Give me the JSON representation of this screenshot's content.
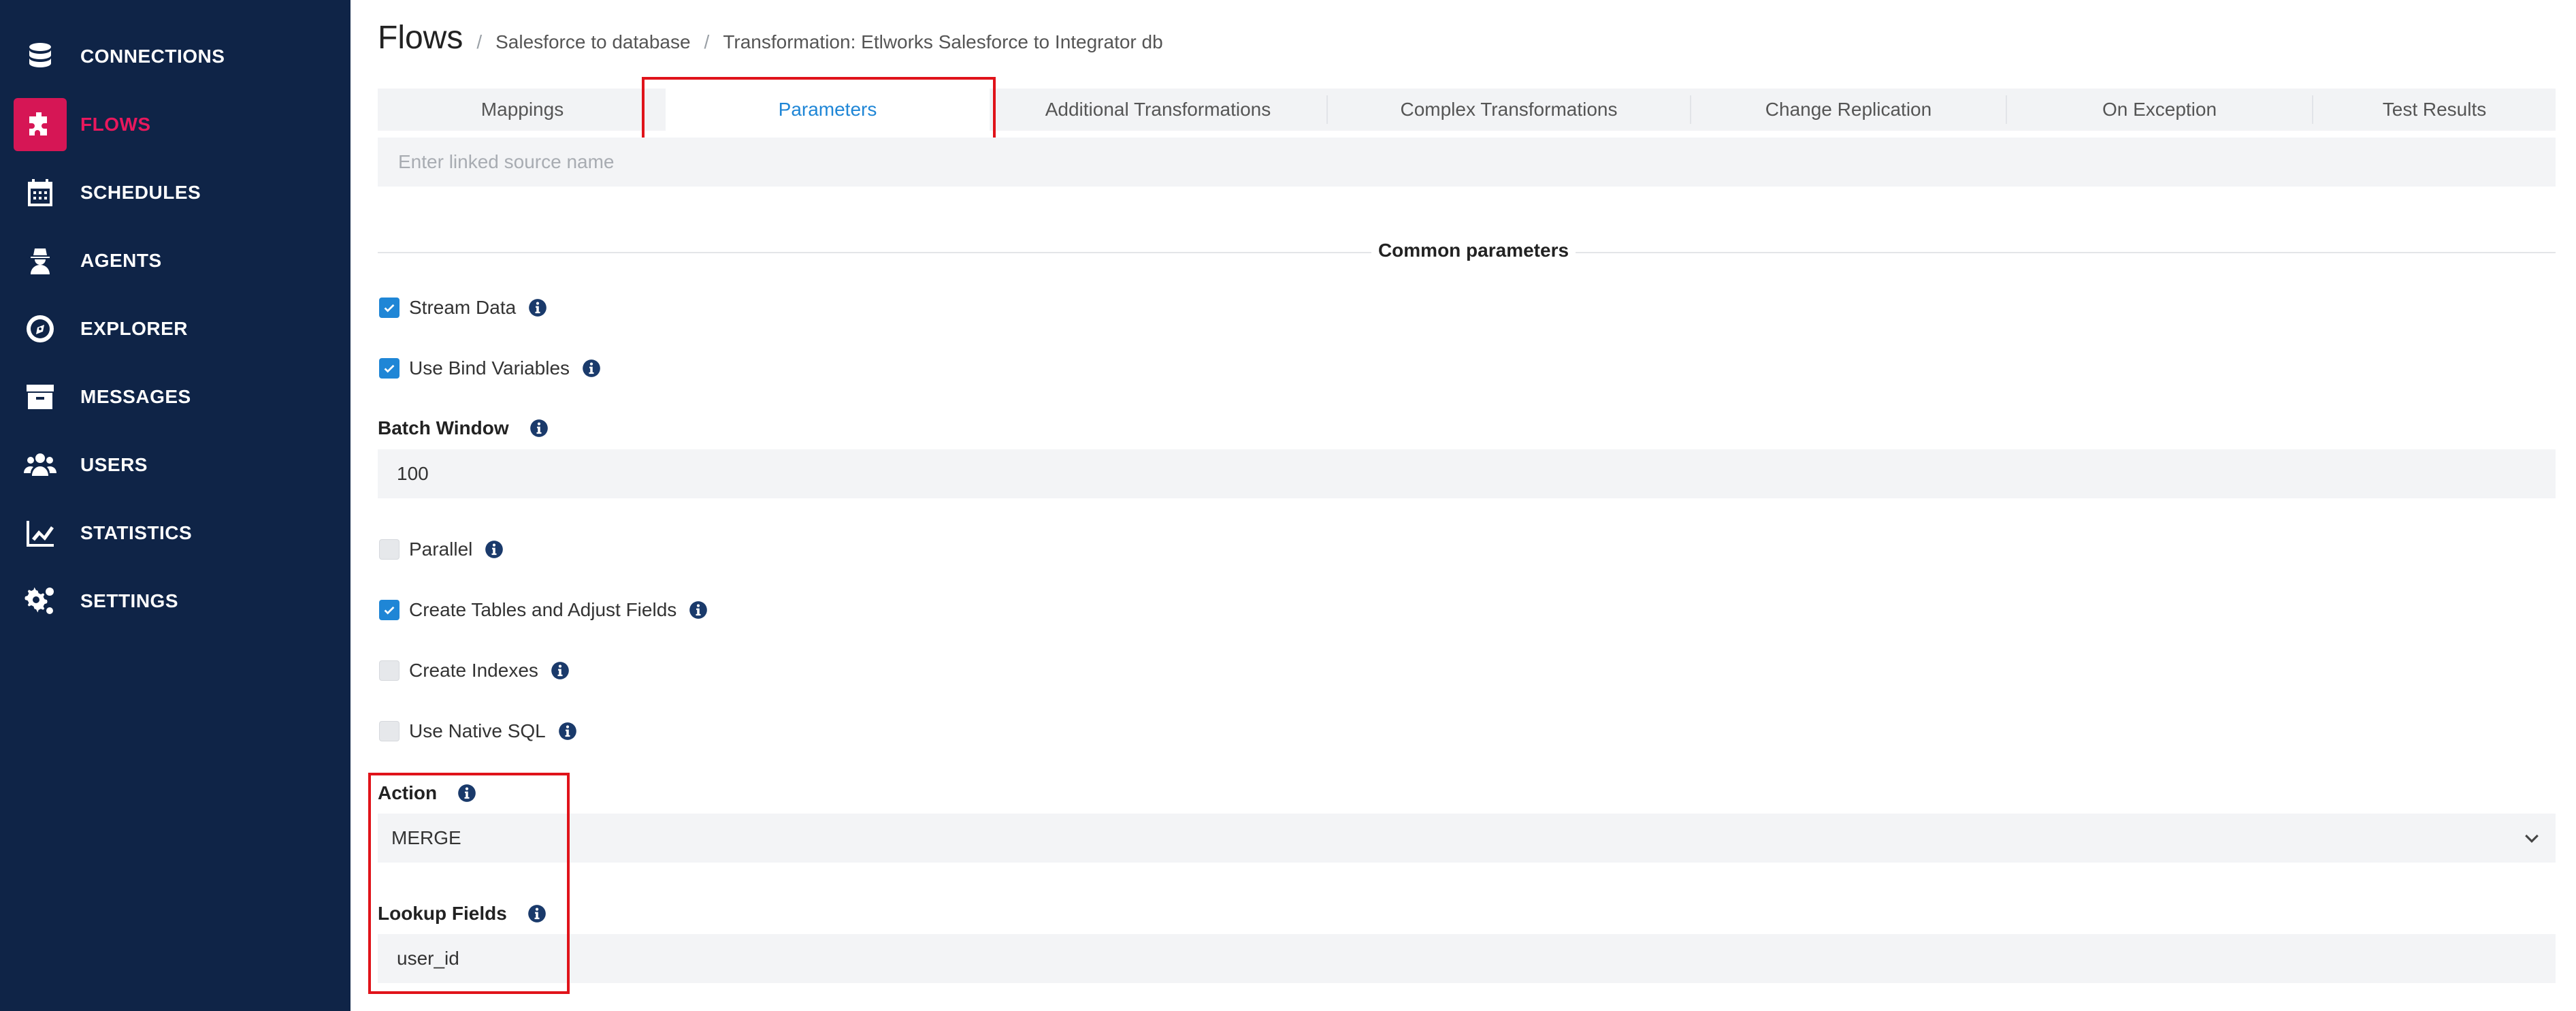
{
  "sidebar": {
    "items": [
      {
        "label": "CONNECTIONS",
        "icon": "database-icon"
      },
      {
        "label": "FLOWS",
        "icon": "puzzle-icon"
      },
      {
        "label": "SCHEDULES",
        "icon": "calendar-icon"
      },
      {
        "label": "AGENTS",
        "icon": "agent-icon"
      },
      {
        "label": "EXPLORER",
        "icon": "compass-icon"
      },
      {
        "label": "MESSAGES",
        "icon": "archive-icon"
      },
      {
        "label": "USERS",
        "icon": "users-icon"
      },
      {
        "label": "STATISTICS",
        "icon": "chart-line-icon"
      },
      {
        "label": "SETTINGS",
        "icon": "gears-icon"
      }
    ],
    "active_color": "#e8185d",
    "background": "#0f2447"
  },
  "breadcrumb": {
    "title": "Flows",
    "items": [
      "Salesforce to database",
      "Transformation: Etlworks Salesforce to Integrator db"
    ]
  },
  "tabs": [
    "Mappings",
    "Parameters",
    "Additional Transformations",
    "Complex Transformations",
    "Change Replication",
    "On Exception",
    "Test Results"
  ],
  "active_tab": "Parameters",
  "linked_source": {
    "placeholder": "Enter linked source name",
    "value": ""
  },
  "section": {
    "title": "Common parameters"
  },
  "params": {
    "stream_data": {
      "label": "Stream Data",
      "checked": true
    },
    "use_bind_variables": {
      "label": "Use Bind Variables",
      "checked": true
    },
    "batch_window": {
      "label": "Batch Window",
      "value": "100"
    },
    "parallel": {
      "label": "Parallel",
      "checked": false
    },
    "create_tables": {
      "label": "Create Tables and Adjust Fields",
      "checked": true
    },
    "create_indexes": {
      "label": "Create Indexes",
      "checked": false
    },
    "use_native_sql": {
      "label": "Use Native SQL",
      "checked": false
    },
    "action": {
      "label": "Action",
      "value": "MERGE"
    },
    "lookup_fields": {
      "label": "Lookup Fields",
      "value": "user_id"
    }
  },
  "colors": {
    "accent": "#1f86d6",
    "highlight": "#e0131a"
  }
}
